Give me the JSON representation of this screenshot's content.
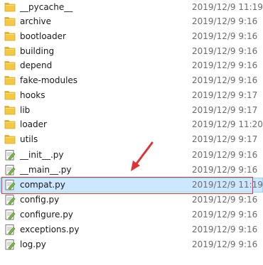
{
  "files": [
    {
      "name": "__pycache__",
      "date": "2019/12/9 11:19",
      "type": "folder"
    },
    {
      "name": "archive",
      "date": "2019/12/9 9:16",
      "type": "folder"
    },
    {
      "name": "bootloader",
      "date": "2019/12/9 9:16",
      "type": "folder"
    },
    {
      "name": "building",
      "date": "2019/12/9 9:16",
      "type": "folder"
    },
    {
      "name": "depend",
      "date": "2019/12/9 9:16",
      "type": "folder"
    },
    {
      "name": "fake-modules",
      "date": "2019/12/9 9:16",
      "type": "folder"
    },
    {
      "name": "hooks",
      "date": "2019/12/9 9:17",
      "type": "folder"
    },
    {
      "name": "lib",
      "date": "2019/12/9 9:17",
      "type": "folder"
    },
    {
      "name": "loader",
      "date": "2019/12/9 11:20",
      "type": "folder"
    },
    {
      "name": "utils",
      "date": "2019/12/9 9:17",
      "type": "folder"
    },
    {
      "name": "__init__.py",
      "date": "2019/12/9 9:16",
      "type": "py"
    },
    {
      "name": "__main__.py",
      "date": "2019/12/9 9:16",
      "type": "py"
    },
    {
      "name": "compat.py",
      "date": "2019/12/9 11:19",
      "type": "py",
      "selected": true
    },
    {
      "name": "config.py",
      "date": "2019/12/9 9:16",
      "type": "py"
    },
    {
      "name": "configure.py",
      "date": "2019/12/9 9:16",
      "type": "py"
    },
    {
      "name": "exceptions.py",
      "date": "2019/12/9 9:16",
      "type": "py"
    },
    {
      "name": "log.py",
      "date": "2019/12/9 9:16",
      "type": "py"
    }
  ],
  "colors": {
    "folder": "#f4c842",
    "selection": "#cce8ff",
    "annotation": "#e03434"
  },
  "annotation": {
    "target": "compat.py",
    "shape": "red-box-with-arrow"
  }
}
